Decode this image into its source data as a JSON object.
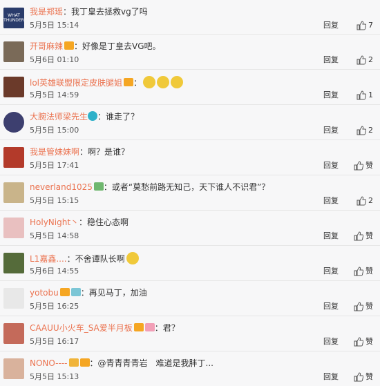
{
  "comments": [
    {
      "user": "我是郑瑶",
      "content": "：我丁皇去拯救vg了吗",
      "date": "5月5日 15:14",
      "reply": "回复",
      "like_text": "7",
      "avatar_color": "#2a3c6b"
    },
    {
      "user": "开哥麻辣",
      "content": "：好像是丁皇去VG吧。",
      "date": "5月6日 01:10",
      "reply": "回复",
      "like_text": "2",
      "avatar_color": "#7a6a58"
    },
    {
      "user": "lol英雄联盟限定皮肤腿姐",
      "content": "：",
      "date": "5月5日 14:59",
      "reply": "回复",
      "like_text": "1",
      "avatar_color": "#6b3a2a"
    },
    {
      "user": "大腕法师梁先生",
      "content": "：谁走了？",
      "date": "5月5日 15:00",
      "reply": "回复",
      "like_text": "2",
      "avatar_color": "#3d3f6f"
    },
    {
      "user": "我是管妹妹啊",
      "content": "：啊？是谁？",
      "date": "5月5日 17:41",
      "reply": "回复",
      "like_text": "赞",
      "avatar_color": "#b33a2a"
    },
    {
      "user": "neverland1025",
      "content": "：或者“莫愁前路无知己，天下谁人不识君”？",
      "date": "5月5日 15:15",
      "reply": "回复",
      "like_text": "2",
      "avatar_color": "#c9b48a"
    },
    {
      "user": "HolyNight丶",
      "content": "：稳住心态啊",
      "date": "5月5日 14:58",
      "reply": "回复",
      "like_text": "赞",
      "avatar_color": "#e9c0c0"
    },
    {
      "user": "L1嘉鑫....",
      "content": "：不舍谭队长啊",
      "date": "5月6日 14:55",
      "reply": "回复",
      "like_text": "赞",
      "avatar_color": "#556b3a"
    },
    {
      "user": "yotobu",
      "content": "：再见马丁，加油",
      "date": "5月5日 16:25",
      "reply": "回复",
      "like_text": "赞",
      "avatar_color": "#e8e8e8"
    },
    {
      "user": "CAAUU小火车_SA爱半月板",
      "content": "：君？",
      "date": "5月5日 16:17",
      "reply": "回复",
      "like_text": "赞",
      "avatar_color": "#c46a5a"
    },
    {
      "user": "NONO----",
      "content": "：@青青青青岩　难道是我胖丁...",
      "date": "5月5日 15:13",
      "reply": "回复",
      "like_text": "赞",
      "avatar_color": "#d9b29c"
    }
  ]
}
